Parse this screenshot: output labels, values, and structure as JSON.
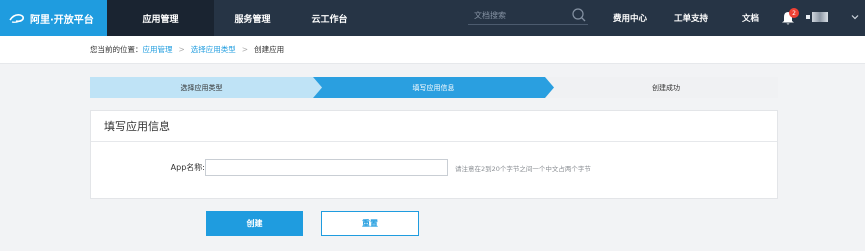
{
  "colors": {
    "brand_blue": "#1f9cdf",
    "nav_bg": "#263445",
    "nav_active_bg": "#1a2431",
    "step_done": "#bfe3f6",
    "step_active": "#2a9fe0",
    "step_pending": "#f0f1f3",
    "badge_red": "#f04134"
  },
  "brand": {
    "name": "阿里·开放平台",
    "icon": "alibaba-logo-icon"
  },
  "nav": {
    "items": [
      {
        "label": "应用管理",
        "active": true
      },
      {
        "label": "服务管理",
        "active": false
      },
      {
        "label": "云工作台",
        "active": false
      }
    ],
    "search_placeholder": "文档搜索",
    "right_links": [
      "费用中心",
      "工单支持",
      "文档"
    ],
    "notification_count": "2"
  },
  "breadcrumb": {
    "prefix": "您当前的位置：",
    "items": [
      "应用管理",
      "选择应用类型",
      "创建应用"
    ]
  },
  "steps": [
    {
      "label": "选择应用类型",
      "state": "done"
    },
    {
      "label": "填写应用信息",
      "state": "active"
    },
    {
      "label": "创建成功",
      "state": "pending"
    }
  ],
  "panel": {
    "title": "填写应用信息",
    "field_label": "App名称:",
    "field_value": "",
    "field_hint": "请注意在2到20个字节之间一个中文占两个字节"
  },
  "buttons": {
    "create": "创建",
    "reset": "重置"
  }
}
